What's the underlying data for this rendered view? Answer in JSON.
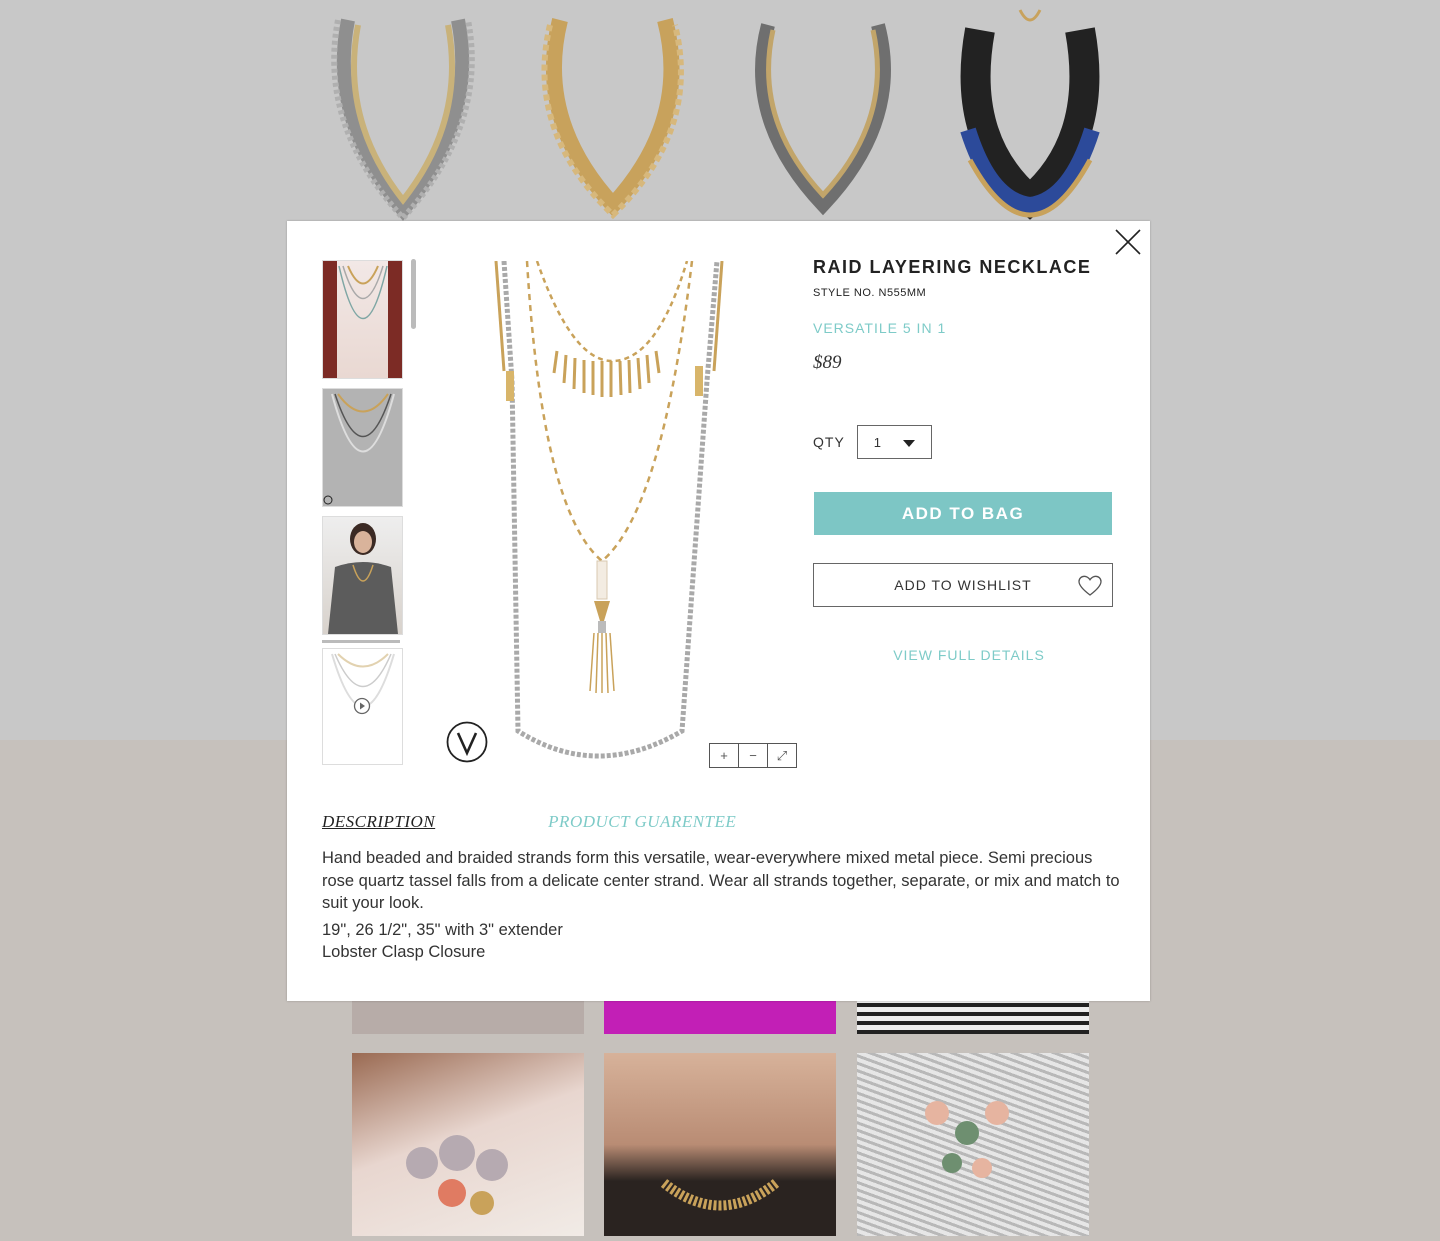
{
  "product": {
    "title": "RAID LAYERING NECKLACE",
    "style_no": "STYLE NO. N555MM",
    "tagline": "VERSATILE 5 IN 1",
    "price": "$89"
  },
  "purchase": {
    "qty_label": "QTY",
    "qty_value": "1",
    "add_to_bag": "ADD TO BAG",
    "add_to_wishlist": "ADD TO WISHLIST",
    "view_full_details": "VIEW FULL DETAILS"
  },
  "tabs": {
    "description": "DESCRIPTION",
    "guarantee": "PRODUCT GUARENTEE"
  },
  "description": {
    "text": "Hand beaded and braided strands form this versatile, wear-everywhere mixed metal piece. Semi precious rose quartz tassel falls from a delicate center strand. Wear all strands together, separate, or mix and match to suit your look.",
    "lengths": "19\", 26 1/2\", 35\" with 3\" extender",
    "closure": "Lobster Clasp Closure"
  },
  "viewer": {
    "zoom_in": "+",
    "zoom_out": "−",
    "fullscreen": "⤢"
  },
  "colors": {
    "accent": "#7dc6c5",
    "gold": "#c9a25a",
    "silver": "#a9a9a9"
  }
}
